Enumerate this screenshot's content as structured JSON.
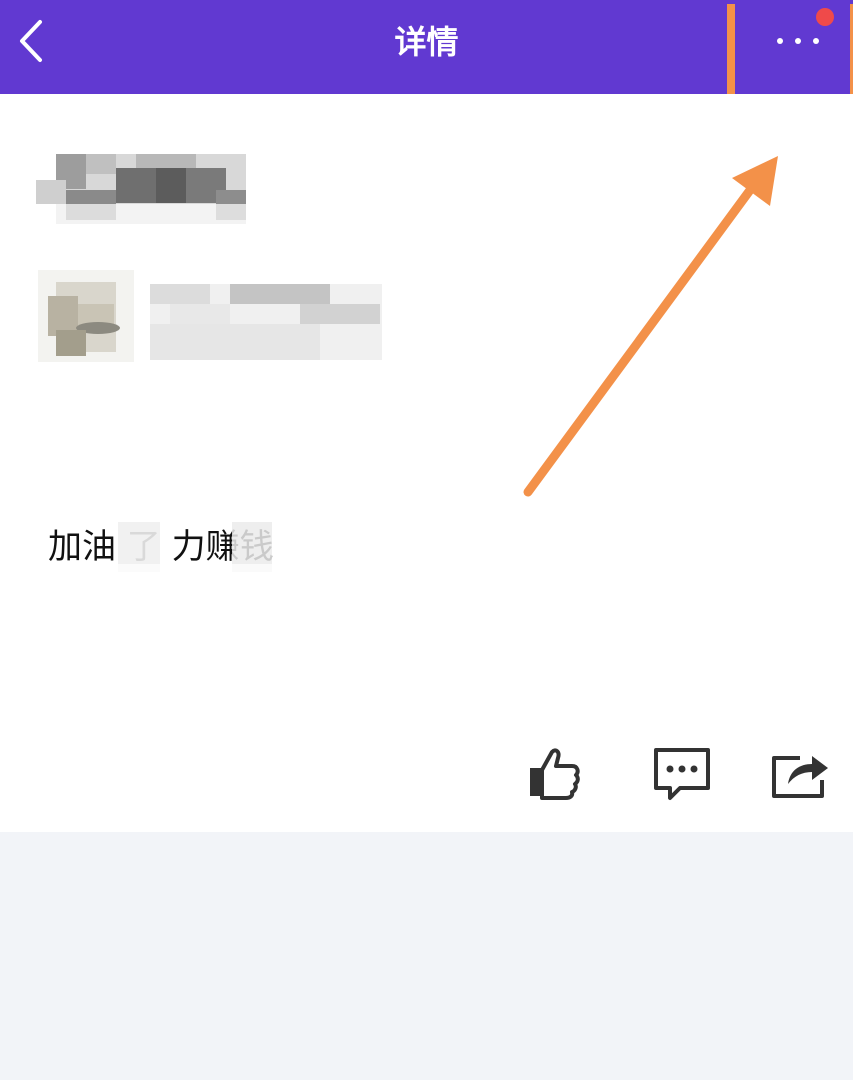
{
  "header": {
    "title": "详情",
    "back_icon": "chevron-left-icon",
    "more_icon": "more-horizontal-icon",
    "notification_dot_color": "#ef4a4a",
    "background": "#6139d1"
  },
  "post": {
    "text": "加油   了  力赚钱"
  },
  "actions": {
    "like_icon": "thumbs-up-icon",
    "comment_icon": "comment-icon",
    "share_icon": "share-icon"
  },
  "annotation": {
    "color": "#f39149"
  }
}
